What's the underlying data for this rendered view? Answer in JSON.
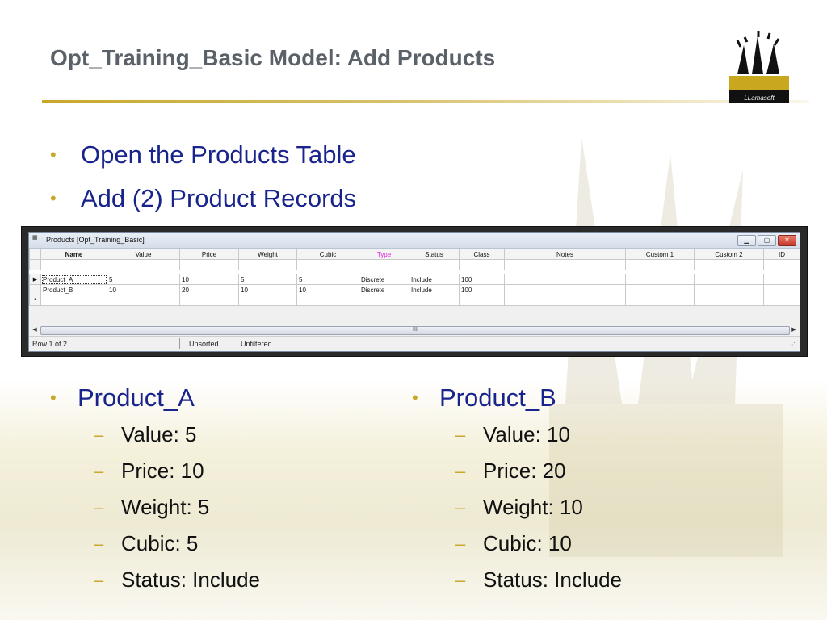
{
  "slide": {
    "title": "Opt_Training_Basic Model: Add Products",
    "bullets": [
      "Open the Products Table",
      "Add (2) Product Records"
    ],
    "logo_text": "LLamasoft",
    "colors": {
      "title": "#5b6168",
      "bullet_text": "#18238c",
      "accent": "#c8a82a"
    }
  },
  "window": {
    "title": "Products [Opt_Training_Basic]",
    "icon": "table-icon",
    "buttons": {
      "minimize": "minimize-icon",
      "restore": "restore-icon",
      "close": "close-icon"
    },
    "columns": [
      "Name",
      "Value",
      "Price",
      "Weight",
      "Cubic",
      "Type",
      "Status",
      "Class",
      "Notes",
      "Custom 1",
      "Custom 2",
      "ID"
    ],
    "rows": [
      [
        "Product_A",
        "5",
        "10",
        "5",
        "5",
        "Discrete",
        "Include",
        "100",
        "",
        "",
        "",
        ""
      ],
      [
        "Product_B",
        "10",
        "20",
        "10",
        "10",
        "Discrete",
        "Include",
        "100",
        "",
        "",
        "",
        ""
      ]
    ],
    "new_row_marker": "*",
    "current_row_marker": "▶",
    "scroll_grip": "III",
    "status": {
      "record": "Row 1 of 2",
      "sort": "Unsorted",
      "filter": "Unfiltered"
    }
  },
  "products": [
    {
      "name": "Product_A",
      "items": [
        "Value: 5",
        "Price: 10",
        "Weight: 5",
        "Cubic: 5",
        "Status: Include"
      ]
    },
    {
      "name": "Product_B",
      "items": [
        "Value: 10",
        "Price: 20",
        "Weight: 10",
        "Cubic: 10",
        "Status: Include"
      ]
    }
  ]
}
